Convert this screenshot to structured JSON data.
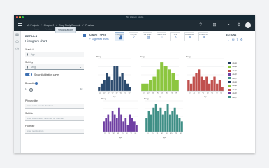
{
  "window": {
    "title": "IBM Watson Studio"
  },
  "topbar": {
    "breadcrumbs": [
      "My Projects",
      "/",
      "Chapter 8",
      "/",
      "Drug Study Example",
      "/",
      "Preview"
    ],
    "icons": [
      "help-icon",
      "app-switcher-icon",
      "notification-icon",
      "settings-icon"
    ]
  },
  "tabs": [
    "Data",
    "Profile",
    "Visualizations"
  ],
  "details": {
    "heading": "DETAILS",
    "chart_name": "Histogram chart",
    "xaxis_label": "X-axis *",
    "xaxis_value": "Age",
    "splitby_label": "Split by",
    "splitby_value": "Drug",
    "show_curve_label": "Show distribution curve",
    "bin_width_label": "Bin width",
    "bin_min": "1",
    "bin_max": "10",
    "primary_title_label": "Primary title",
    "primary_title_placeholder": "Enter a title text for the chart",
    "subtitle_label": "Subtitle",
    "subtitle_placeholder": "Enter a secondary label title for the chart",
    "footnote_label": "Footnote",
    "footnote_placeholder": "Enter text footnote"
  },
  "chart_types": {
    "heading": "CHART TYPES",
    "suggested": "+ Suggested charts",
    "items": [
      "Histogram",
      "Q-Q plot",
      "Bar graph",
      "Scatter plot",
      "Line",
      "Multi-series",
      "Parallel coor..."
    ]
  },
  "actions": {
    "heading": "ACTIONS"
  },
  "colors": {
    "drugA": "#1f3a5f",
    "drugB": "#8cc63f",
    "drugC": "#c0504d",
    "drugX": "#6f3fa3",
    "drugY": "#3f8f86"
  },
  "chart_data": [
    {
      "type": "bar",
      "title": "",
      "subtitle": "drugA",
      "xlabel": "Age",
      "ylabel": "",
      "color": "#2c4b6e",
      "values": [
        1,
        2,
        3,
        5,
        4,
        3,
        7,
        7,
        4,
        5,
        3,
        2,
        1
      ]
    },
    {
      "type": "bar",
      "title": "",
      "subtitle": "drugB",
      "xlabel": "Age",
      "ylabel": "",
      "color": "#8cc63f",
      "values": [
        2,
        2,
        3,
        4,
        6,
        8,
        7,
        6,
        5,
        3
      ]
    },
    {
      "type": "bar",
      "title": "",
      "subtitle": "drugC",
      "xlabel": "Age",
      "ylabel": "",
      "color": "#c0504d",
      "values": [
        3,
        2,
        4,
        5,
        6,
        4,
        3,
        4,
        2,
        3,
        4,
        2,
        3,
        1
      ]
    },
    {
      "type": "bar",
      "title": "",
      "subtitle": "drugX",
      "xlabel": "Age",
      "ylabel": "",
      "color": "#6f3fa3",
      "values": [
        3,
        4,
        5,
        3,
        6,
        5,
        4,
        7,
        5,
        3,
        4,
        2,
        5,
        4,
        3,
        2
      ]
    },
    {
      "type": "bar",
      "title": "",
      "subtitle": "drugY",
      "xlabel": "Age",
      "ylabel": "",
      "color": "#3f8f86",
      "values": [
        4,
        6,
        5,
        7,
        8,
        6,
        7,
        5,
        6,
        8,
        5,
        6,
        7,
        5,
        4,
        3
      ]
    }
  ],
  "legend": {
    "items": [
      {
        "label": "drugA",
        "color": "#1f3a5f"
      },
      {
        "label": "drugB",
        "color": "#8cc63f"
      },
      {
        "label": "drugC",
        "color": "#c0504d"
      },
      {
        "label": "drugX",
        "color": "#6f3fa3"
      },
      {
        "label": "drugY",
        "color": "#3f8f86"
      },
      {
        "label": "drugA",
        "color": "#1f3a5f"
      },
      {
        "label": "drugB",
        "color": "#8cc63f"
      },
      {
        "label": "drugC",
        "color": "#c0504d"
      },
      {
        "label": "drugX",
        "color": "#6f3fa3"
      },
      {
        "label": "drugY",
        "color": "#3f8f86"
      }
    ]
  },
  "axis": {
    "ylabel": "Drug",
    "xlabel": "Age",
    "ticks": [
      "10",
      "20",
      "30",
      "40",
      "50",
      "60",
      "70",
      "80"
    ]
  }
}
